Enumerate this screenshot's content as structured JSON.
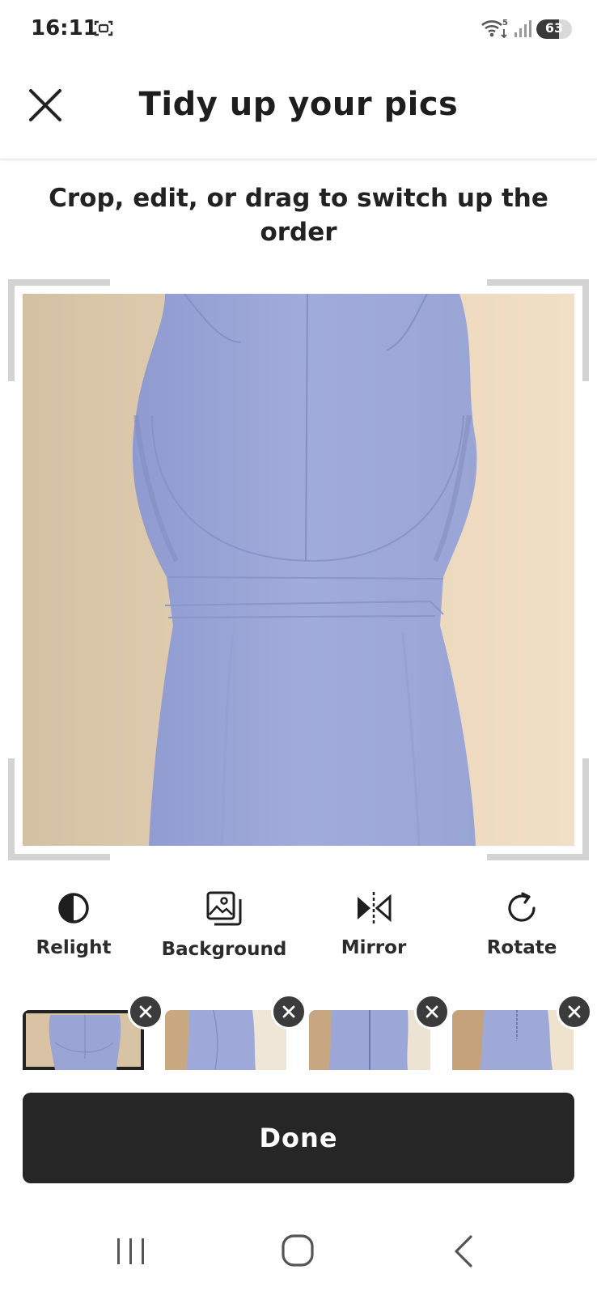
{
  "status_bar": {
    "time": "16:11",
    "battery_level": "63",
    "screenshot_icon": "screenshot-icon",
    "wifi_icon": "wifi-5-icon",
    "signal_icon": "signal-icon"
  },
  "header": {
    "title": "Tidy up your pics",
    "close_icon": "close-icon"
  },
  "subtitle": "Crop, edit, or drag to switch up the order",
  "tools": [
    {
      "label": "Relight",
      "icon": "contrast-icon"
    },
    {
      "label": "Background",
      "icon": "background-icon"
    },
    {
      "label": "Mirror",
      "icon": "mirror-icon"
    },
    {
      "label": "Rotate",
      "icon": "rotate-icon"
    }
  ],
  "thumbnails": {
    "count": 4,
    "selected_index": 0,
    "remove_icon": "remove-icon"
  },
  "done_label": "Done",
  "nav_bar": {
    "recents_icon": "recents-icon",
    "home_icon": "home-icon",
    "back_icon": "back-icon"
  },
  "colors": {
    "dark": "#262626",
    "dress": "#9aa6d6",
    "wall": "#e8d2b2"
  }
}
